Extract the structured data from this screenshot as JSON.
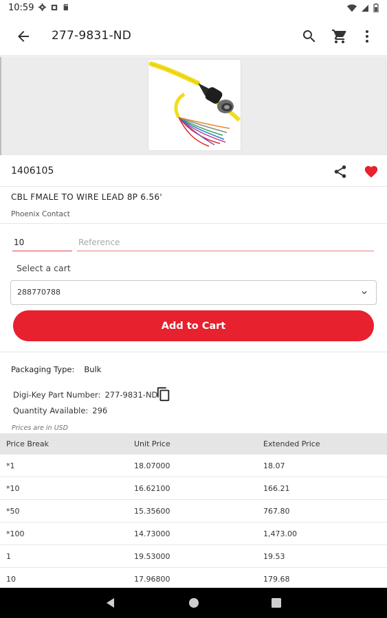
{
  "status_bar": {
    "time": "10:59"
  },
  "app_bar": {
    "title": "277-9831-ND"
  },
  "product": {
    "part_number": "1406105",
    "description": "CBL FMALE TO WIRE LEAD 8P 6.56'",
    "manufacturer": "Phoenix Contact"
  },
  "order_form": {
    "quantity_value": "10",
    "reference_placeholder": "Reference",
    "select_cart_label": "Select a cart",
    "cart_selected": "288770788",
    "add_to_cart_label": "Add to Cart"
  },
  "details": {
    "packaging_label": "Packaging Type:",
    "packaging_value": "Bulk",
    "digikey_label": "Digi-Key Part Number:",
    "digikey_value": "277-9831-ND",
    "qty_available_label": "Quantity Available:",
    "qty_available_value": "296",
    "prices_note": "Prices are in USD"
  },
  "price_table": {
    "headers": [
      "Price Break",
      "Unit Price",
      "Extended Price"
    ],
    "rows": [
      [
        "*1",
        "18.07000",
        "18.07"
      ],
      [
        "*10",
        "16.62100",
        "166.21"
      ],
      [
        "*50",
        "15.35600",
        "767.80"
      ],
      [
        "*100",
        "14.73000",
        "1,473.00"
      ],
      [
        "1",
        "19.53000",
        "19.53"
      ],
      [
        "10",
        "17.96800",
        "179.68"
      ]
    ]
  },
  "colors": {
    "accent": "#e7212d",
    "favorite": "#e7212d"
  },
  "icons": {
    "back": "arrow-back-icon",
    "search": "search-icon",
    "cart": "cart-icon",
    "more": "more-vert-icon",
    "share": "share-icon",
    "favorite": "heart-icon",
    "copy": "copy-icon",
    "dropdown": "chevron-down-icon"
  }
}
